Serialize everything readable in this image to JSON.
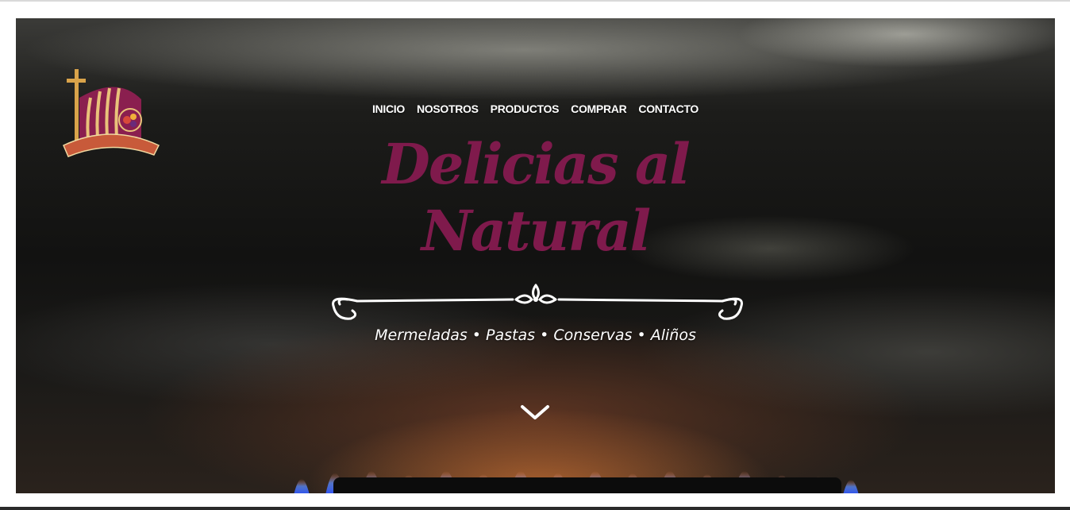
{
  "nav": {
    "items": [
      {
        "label": "INICIO"
      },
      {
        "label": "NOSOTROS"
      },
      {
        "label": "PRODUCTOS"
      },
      {
        "label": "COMPRAR"
      },
      {
        "label": "CONTACTO"
      }
    ]
  },
  "hero": {
    "title_line1": "Delicias al",
    "title_line2": "Natural",
    "tagline": "Mermeladas • Pastas • Conservas • Aliños",
    "scroll_icon": "chevron-down-icon"
  },
  "logo": {
    "text": "Delicias al Natural",
    "icon": "logo-barrel-cross"
  },
  "colors": {
    "brand": "#7f1a4c",
    "nav_text": "#ffffff",
    "logo_ribbon": "#c85a3a",
    "logo_barrel": "#8a1f4f"
  }
}
